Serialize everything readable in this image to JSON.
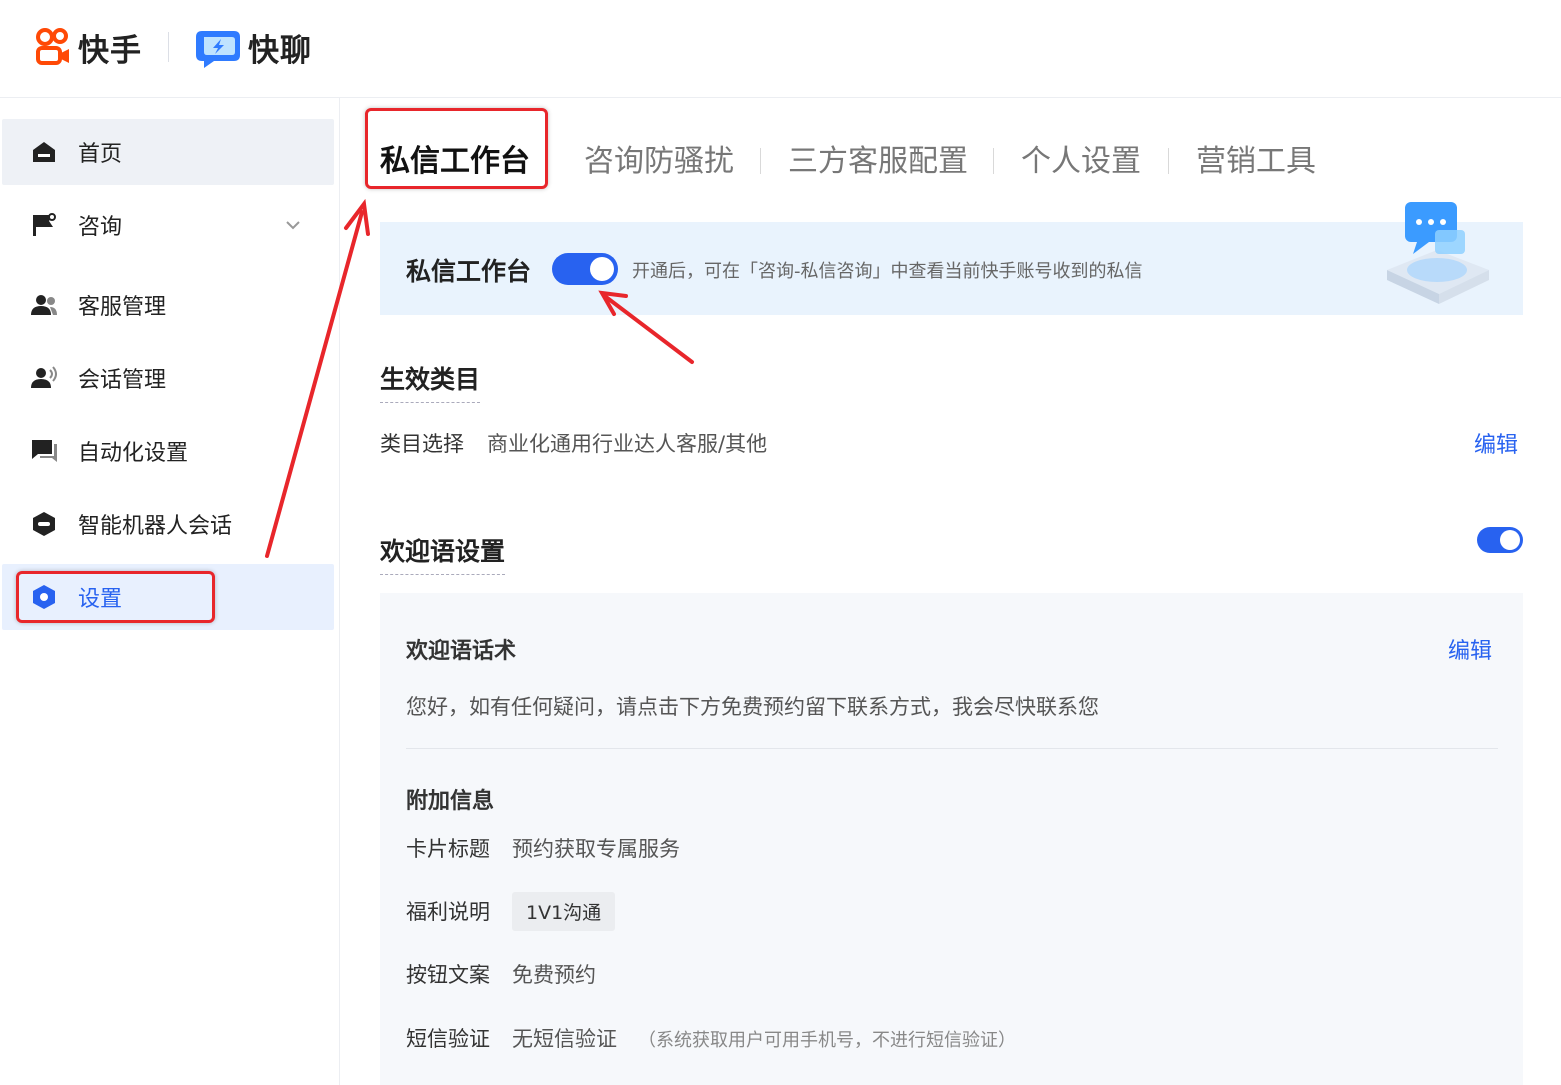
{
  "header": {
    "brand_kuaishou": "快手",
    "brand_kuailiao": "快聊"
  },
  "sidebar": {
    "items": [
      {
        "label": "首页",
        "icon": "home-icon"
      },
      {
        "label": "咨询",
        "icon": "flag-icon"
      },
      {
        "label": "客服管理",
        "icon": "users-icon"
      },
      {
        "label": "会话管理",
        "icon": "user-voice-icon"
      },
      {
        "label": "自动化设置",
        "icon": "chat-icon"
      },
      {
        "label": "智能机器人会话",
        "icon": "robot-icon"
      },
      {
        "label": "设置",
        "icon": "settings-icon"
      }
    ],
    "active_index": 6
  },
  "tabs": [
    "私信工作台",
    "咨询防骚扰",
    "三方客服配置",
    "个人设置",
    "营销工具"
  ],
  "banner": {
    "title": "私信工作台",
    "toggle_on": true,
    "description": "开通后，可在「咨询-私信咨询」中查看当前快手账号收到的私信"
  },
  "category_section": {
    "title": "生效类目",
    "label": "类目选择",
    "value": "商业化通用行业达人客服/其他",
    "edit": "编辑"
  },
  "welcome_section": {
    "title": "欢迎语设置",
    "toggle_on": true,
    "script_title": "欢迎语话术",
    "script_edit": "编辑",
    "script_text": "您好，如有任何疑问，请点击下方免费预约留下联系方式，我会尽快联系您",
    "extra_title": "附加信息",
    "card_title_label": "卡片标题",
    "card_title_value": "预约获取专属服务",
    "benefit_label": "福利说明",
    "benefit_value": "1V1沟通",
    "button_label": "按钮文案",
    "button_value": "免费预约",
    "sms_label": "短信验证",
    "sms_value": "无短信验证",
    "sms_note": "（系统获取用户可用手机号，不进行短信验证）"
  },
  "colors": {
    "accent": "#2862f0",
    "annotation": "#e8262b",
    "banner_bg": "#e9f3fd"
  }
}
